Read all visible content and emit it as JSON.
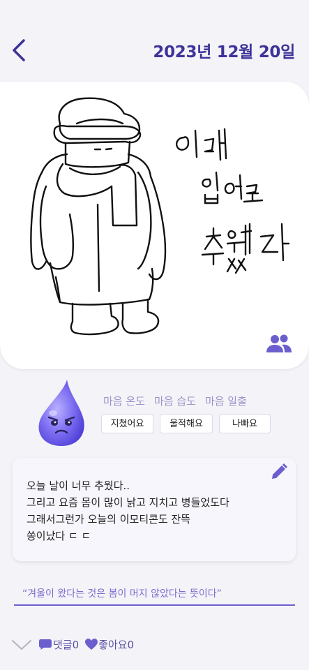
{
  "header": {
    "date": "2023년 12월 20일"
  },
  "drawing": {
    "handwritten_text": [
      "이래",
      "입어도",
      "추웠다"
    ]
  },
  "emotion": {
    "labels": [
      "마음 온도",
      "마음 습도",
      "마음 일출"
    ],
    "values": [
      "지쳤어요",
      "울적해요",
      "나빠요"
    ]
  },
  "note": {
    "lines": [
      "오늘 날이 너무 추웠다..",
      "그리고 요즘 몸이 많이 낡고 지치고 병들었도다",
      "그래서그런가 오늘의 이모티콘도 잔뜩",
      "쏭이났다 ㄷ ㄷ"
    ]
  },
  "quote": {
    "text": "“겨울이 왔다는 것은  봄이 머지 않았다는 뜻이다”"
  },
  "footer": {
    "comments": "댓글0",
    "likes": "좋아요0"
  },
  "colors": {
    "accent": "#3d3399",
    "muted_purple": "#9b94c9",
    "icon_purple": "#6b5fcf",
    "background": "#f4f3f8"
  },
  "icons": [
    "back-chevron-icon",
    "people-icon",
    "droplet-character-icon",
    "pencil-icon",
    "chevron-down-icon",
    "chat-bubble-icon",
    "heart-icon"
  ]
}
